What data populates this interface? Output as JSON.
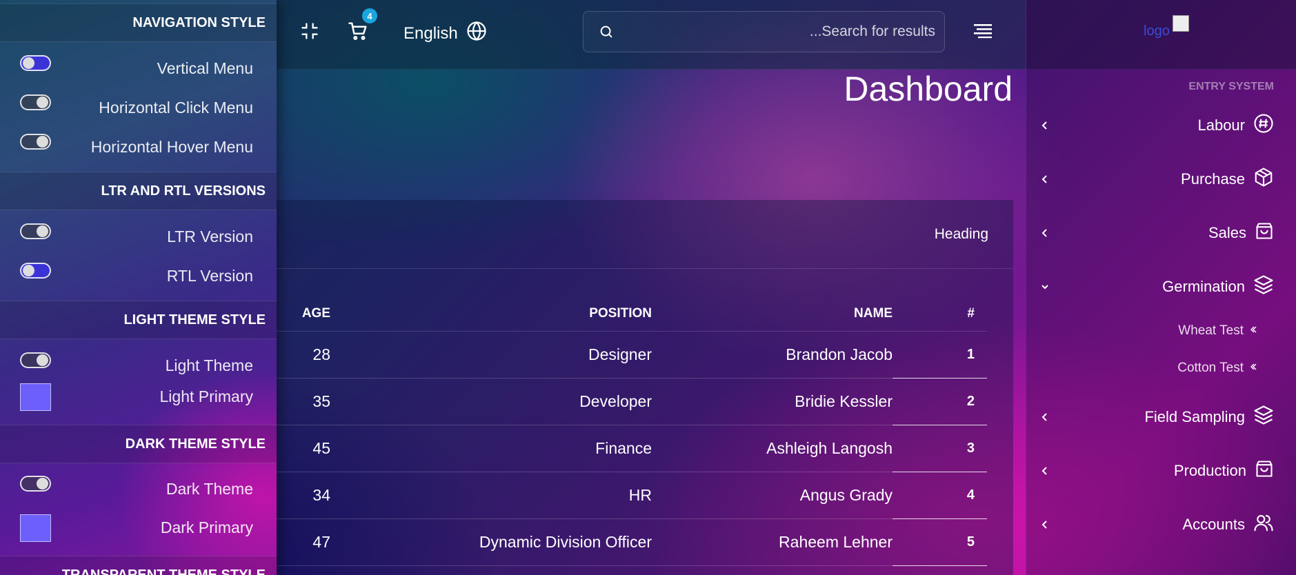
{
  "header": {
    "cart_count": "4",
    "language": "English",
    "search_placeholder": "...Search for results"
  },
  "page": {
    "title": "Dashboard"
  },
  "card": {
    "heading": "Heading",
    "columns": {
      "age": "AGE",
      "position": "POSITION",
      "name": "NAME",
      "num": "#"
    },
    "rows": [
      {
        "num": "1",
        "name": "Brandon Jacob",
        "position": "Designer",
        "age": "28"
      },
      {
        "num": "2",
        "name": "Bridie Kessler",
        "position": "Developer",
        "age": "35"
      },
      {
        "num": "3",
        "name": "Ashleigh Langosh",
        "position": "Finance",
        "age": "45"
      },
      {
        "num": "4",
        "name": "Angus Grady",
        "position": "HR",
        "age": "34"
      },
      {
        "num": "5",
        "name": "Raheem Lehner",
        "position": "Dynamic Division Officer",
        "age": "47"
      }
    ]
  },
  "sidebar": {
    "logo_alt": "logo",
    "section": "ENTRY SYSTEM",
    "items": [
      {
        "label": "Labour",
        "icon": "hash-badge-icon"
      },
      {
        "label": "Purchase",
        "icon": "box-icon"
      },
      {
        "label": "Sales",
        "icon": "shopping-bag-icon"
      },
      {
        "label": "Germination",
        "icon": "layers-icon"
      },
      {
        "label": "Field Sampling",
        "icon": "layers-icon"
      },
      {
        "label": "Production",
        "icon": "shopping-bag-icon"
      },
      {
        "label": "Accounts",
        "icon": "users-icon"
      }
    ],
    "sub_items": [
      {
        "label": "Wheat Test"
      },
      {
        "label": "Cotton Test"
      }
    ]
  },
  "switcher": {
    "nav_style": {
      "heading": "NAVIGATION STYLE",
      "options": [
        {
          "label": "Vertical Menu",
          "state": "on"
        },
        {
          "label": "Horizontal Click Menu",
          "state": "off"
        },
        {
          "label": "Horizontal Hover Menu",
          "state": "off"
        }
      ]
    },
    "direction": {
      "heading": "LTR AND RTL VERSIONS",
      "options": [
        {
          "label": "LTR Version",
          "state": "off"
        },
        {
          "label": "RTL Version",
          "state": "on"
        }
      ]
    },
    "light_theme": {
      "heading": "LIGHT THEME STYLE",
      "theme_label": "Light Theme",
      "theme_state": "off",
      "primary_label": "Light Primary",
      "primary_color": "#6c5ffc"
    },
    "dark_theme": {
      "heading": "DARK THEME STYLE",
      "theme_label": "Dark Theme",
      "theme_state": "off",
      "primary_label": "Dark Primary",
      "primary_color": "#6c5ffc"
    },
    "transparent_theme": {
      "heading": "TRANSPARENT THEME STYLE"
    }
  }
}
